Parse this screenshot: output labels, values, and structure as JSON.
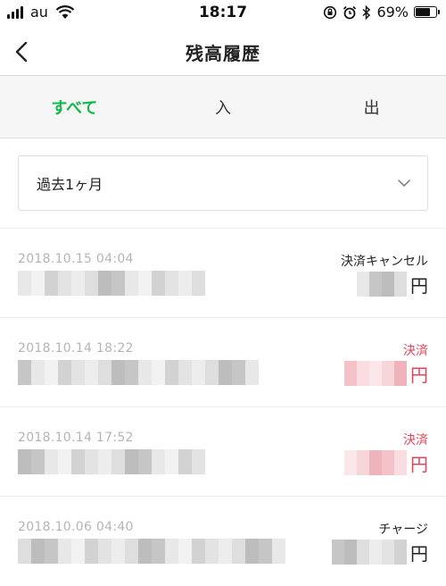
{
  "status_bar": {
    "carrier": "au",
    "time": "18:17",
    "battery": "69%",
    "battery_level": 0.69,
    "icons": [
      "signal-icon",
      "wifi-icon",
      "orientation-lock-icon",
      "alarm-icon",
      "bluetooth-icon",
      "battery-icon"
    ]
  },
  "nav": {
    "title": "残高履歴",
    "back_icon": "chevron-left-icon"
  },
  "tabs": [
    {
      "label": "すべて",
      "active": true
    },
    {
      "label": "入",
      "active": false
    },
    {
      "label": "出",
      "active": false
    }
  ],
  "filter": {
    "selected": "過去1ヶ月",
    "icon": "chevron-down-icon"
  },
  "colors": {
    "accent_green": "#12b84a",
    "payment_red": "#e0435a",
    "date_gray": "#b5b5b5"
  },
  "transactions": [
    {
      "date": "2018.10.15 04:04",
      "type": "決済キャンセル",
      "kind": "cancel",
      "currency": "円",
      "merchant_masked": true,
      "amount_masked": true
    },
    {
      "date": "2018.10.14 18:22",
      "type": "決済",
      "kind": "payment",
      "currency": "円",
      "merchant_masked": true,
      "amount_masked": true
    },
    {
      "date": "2018.10.14 17:52",
      "type": "決済",
      "kind": "payment",
      "currency": "円",
      "merchant_masked": true,
      "amount_masked": true
    },
    {
      "date": "2018.10.06 04:40",
      "type": "チャージ",
      "kind": "charge",
      "currency": "円",
      "merchant_masked": true,
      "amount_masked": true
    }
  ]
}
